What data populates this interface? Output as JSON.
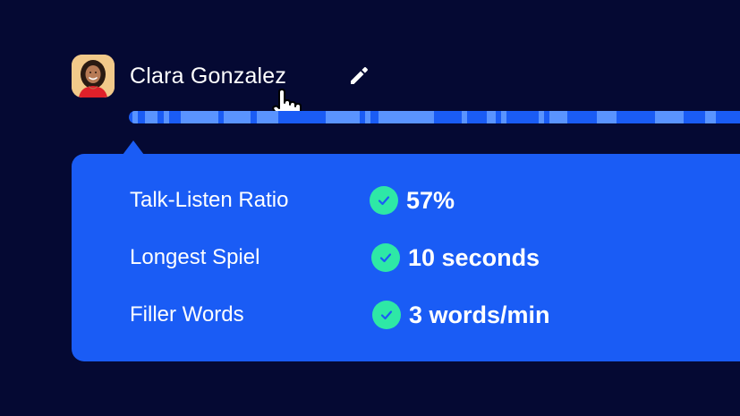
{
  "user": {
    "name": "Clara Gonzalez",
    "avatar_icon": "person-portrait",
    "edit_icon": "pencil-icon"
  },
  "metrics": [
    {
      "label": "Talk-Listen Ratio",
      "value": "57%",
      "status_icon": "check-circle-icon"
    },
    {
      "label": "Longest Spiel",
      "value": "10 seconds",
      "status_icon": "check-circle-icon"
    },
    {
      "label": "Filler Words",
      "value": "3 words/min",
      "status_icon": "check-circle-icon"
    }
  ],
  "colors": {
    "background": "#050933",
    "card": "#1a5cf5",
    "track_segment": "#5a94ff",
    "check": "#2ee8a6",
    "text": "#ffffff"
  }
}
